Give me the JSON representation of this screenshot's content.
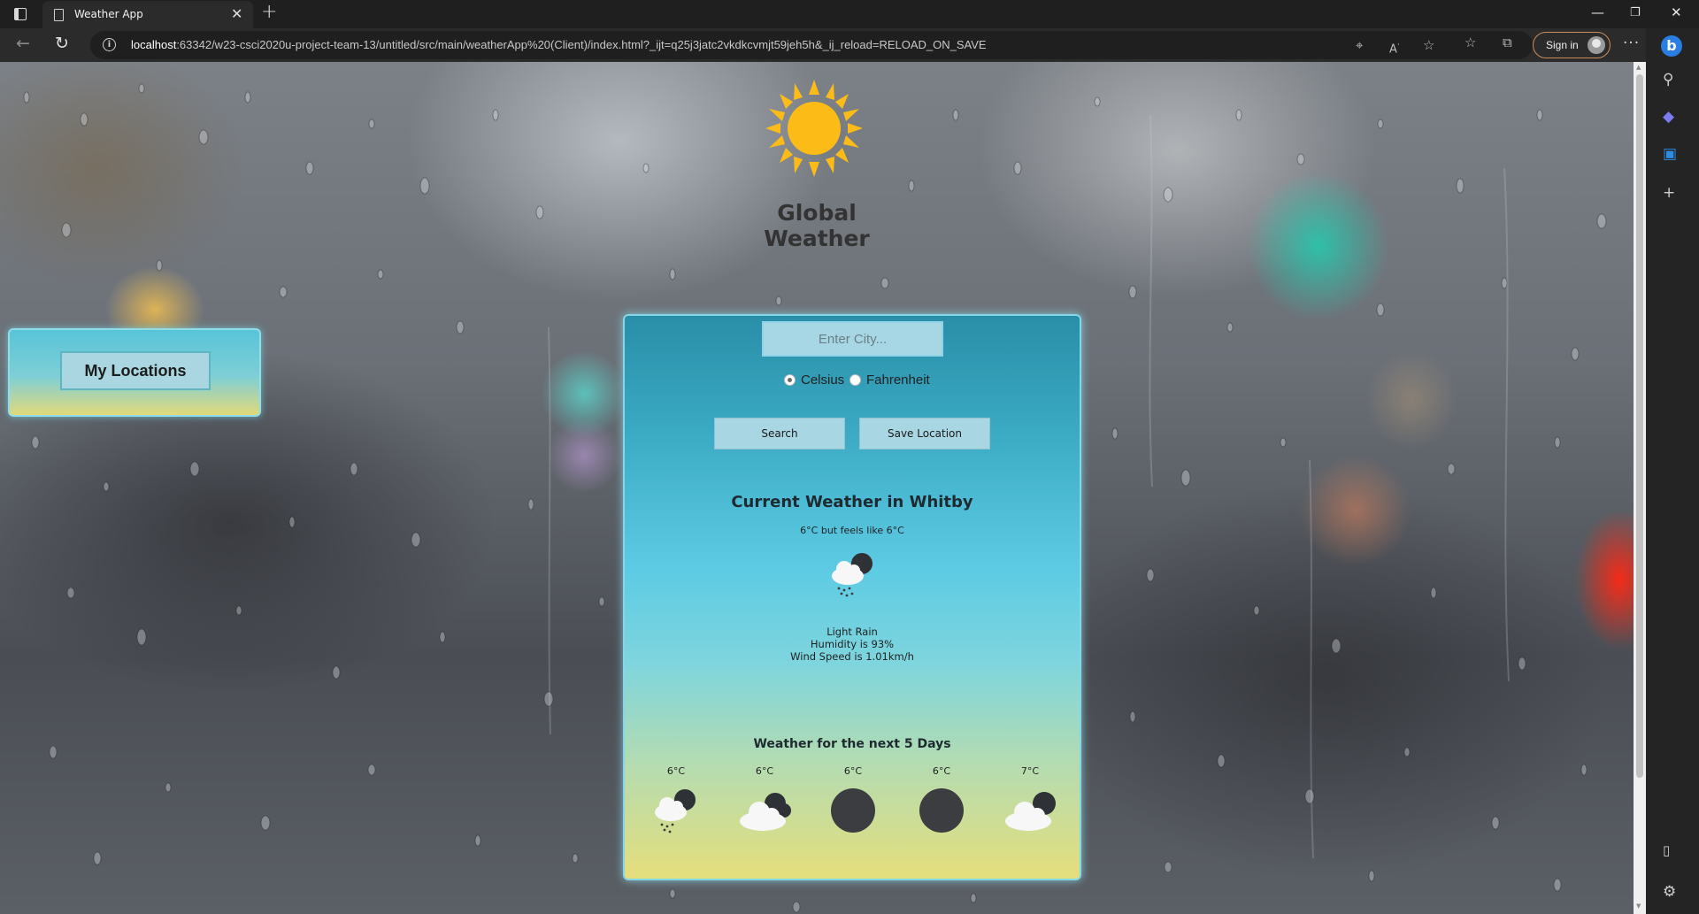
{
  "browser": {
    "tab_title": "Weather App",
    "url_host": "localhost",
    "url_rest": ":63342/w23-csci2020u-project-team-13/untitled/src/main/weatherApp%20(Client)/index.html?_ijt=q25j3jatc2vkdkcvmjt59jeh5h&_ij_reload=RELOAD_ON_SAVE",
    "sign_in_label": "Sign in"
  },
  "app": {
    "title": "Global Weather",
    "my_locations_label": "My Locations",
    "city_placeholder": "Enter City...",
    "unit_celsius": "Celsius",
    "unit_fahrenheit": "Fahrenheit",
    "selected_unit": "Celsius",
    "search_label": "Search",
    "save_location_label": "Save Location"
  },
  "current": {
    "title": "Current Weather in Whitby",
    "temp_line": "6°C but feels like 6°C",
    "icon": "cloud-moon-rain-icon",
    "description": "Light Rain",
    "humidity": "Humidity is 93%",
    "wind": "Wind Speed is 1.01km/h"
  },
  "forecast": {
    "title": "Weather for the next 5 Days",
    "days": [
      {
        "temp": "6°C",
        "icon": "cloud-moon-rain-icon"
      },
      {
        "temp": "6°C",
        "icon": "cloud-moon-icon"
      },
      {
        "temp": "6°C",
        "icon": "dark-circle-icon"
      },
      {
        "temp": "6°C",
        "icon": "dark-circle-icon"
      },
      {
        "temp": "7°C",
        "icon": "cloud-moon-icon"
      }
    ]
  },
  "colors": {
    "card_top": "#2a8ea8",
    "card_mid": "#5dcbe4",
    "card_bottom": "#e5de7b",
    "button_bg": "#a9d6e3",
    "sun": "#fdbb17"
  }
}
